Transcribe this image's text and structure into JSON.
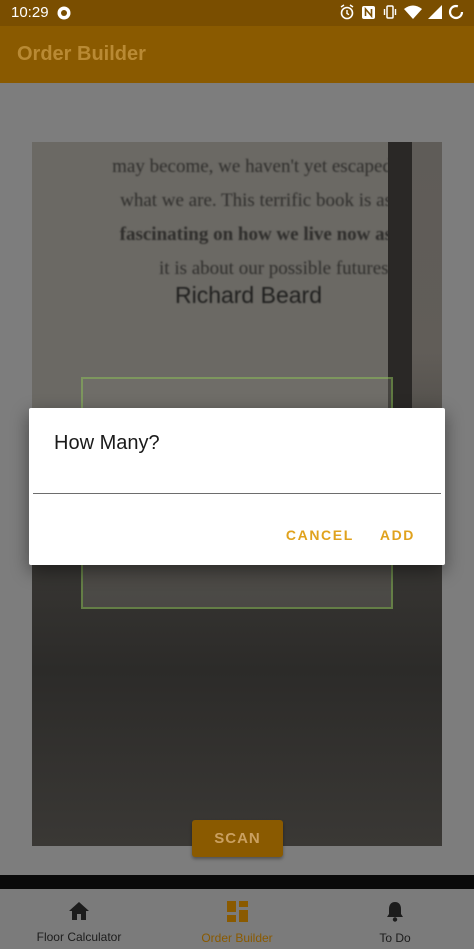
{
  "status_bar": {
    "time": "10:29",
    "icons": [
      "alarm-icon",
      "nfc-icon",
      "vibrate-icon",
      "wifi-icon",
      "signal-icon",
      "battery-icon"
    ]
  },
  "app_bar": {
    "title": "Order Builder"
  },
  "camera": {
    "book_lines": [
      "may become, we haven't yet escaped",
      "what we are. This terrific book is as",
      "fascinating on how we live now as",
      "it is about our possible futures'"
    ],
    "book_author": "Richard Beard"
  },
  "scan_button": {
    "label": "SCAN"
  },
  "dialog": {
    "title": "How Many?",
    "input_value": "",
    "cancel_label": "CANCEL",
    "add_label": "ADD"
  },
  "bottom_nav": {
    "items": [
      {
        "label": "Floor Calculator",
        "icon": "home-icon"
      },
      {
        "label": "Order Builder",
        "icon": "dashboard-icon",
        "active": true
      },
      {
        "label": "To Do",
        "icon": "bell-icon"
      }
    ]
  },
  "colors": {
    "accent": "#e0a21d",
    "app_bar": "#8a5a00",
    "status_bar": "#7a4e00"
  }
}
